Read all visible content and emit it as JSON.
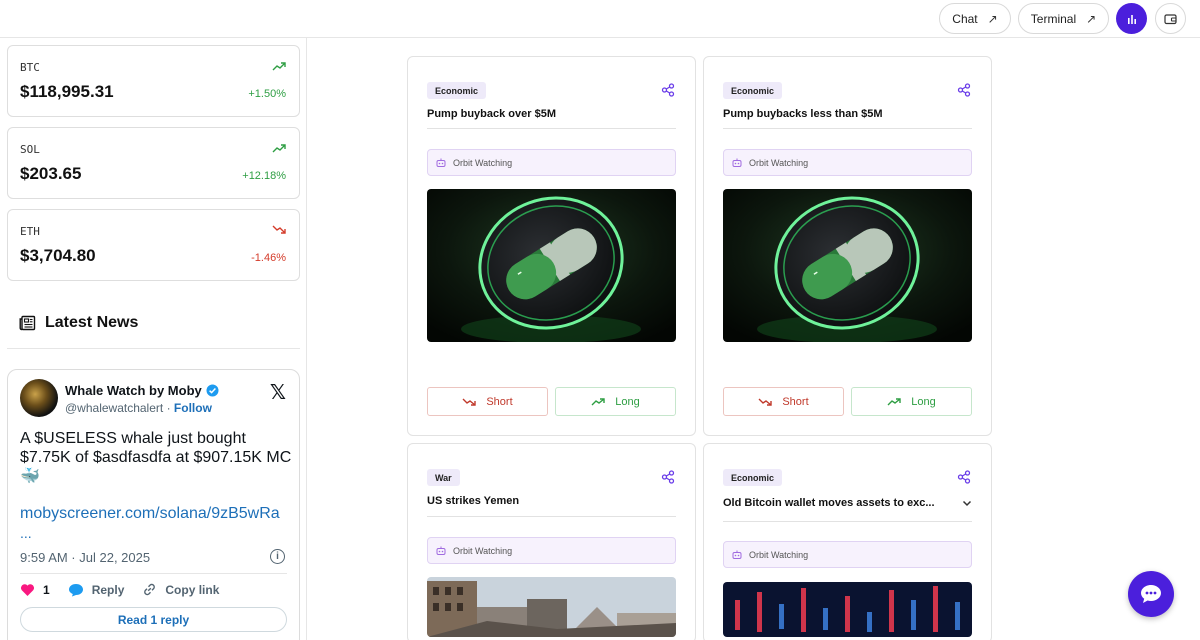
{
  "topbar": {
    "chat_label": "Chat",
    "terminal_label": "Terminal",
    "accent": "#4b1fdc"
  },
  "tickers": [
    {
      "symbol": "BTC",
      "price": "$118,995.31",
      "change": "+1.50%",
      "direction": "up"
    },
    {
      "symbol": "SOL",
      "price": "$203.65",
      "change": "+12.18%",
      "direction": "up"
    },
    {
      "symbol": "ETH",
      "price": "$3,704.80",
      "change": "-1.46%",
      "direction": "down"
    }
  ],
  "news": {
    "heading": "Latest News",
    "tweet": {
      "author": "Whale Watch by Moby",
      "handle": "@whalewatchalert",
      "separator": "·",
      "follow_label": "Follow",
      "text": "A $USELESS whale just bought $7.75K of $asdfasdfa at $907.15K MC 🐳",
      "link": "mobyscreener.com/solana/9zB5wRa",
      "ellipsis": "...",
      "time": "9:59 AM · Jul 22, 2025",
      "likes": "1",
      "reply_label": "Reply",
      "copy_label": "Copy link",
      "read_reply_label": "Read 1 reply"
    }
  },
  "cards": [
    {
      "category": "Economic",
      "title": "Pump buyback over $5M",
      "watch_label": "Orbit Watching",
      "short_label": "Short",
      "long_label": "Long"
    },
    {
      "category": "Economic",
      "title": "Pump buybacks less than $5M",
      "watch_label": "Orbit Watching",
      "short_label": "Short",
      "long_label": "Long"
    },
    {
      "category": "War",
      "title": "US strikes Yemen",
      "watch_label": "Orbit Watching"
    },
    {
      "category": "Economic",
      "title": "Old Bitcoin wallet moves assets to exc...",
      "watch_label": "Orbit Watching"
    }
  ]
}
